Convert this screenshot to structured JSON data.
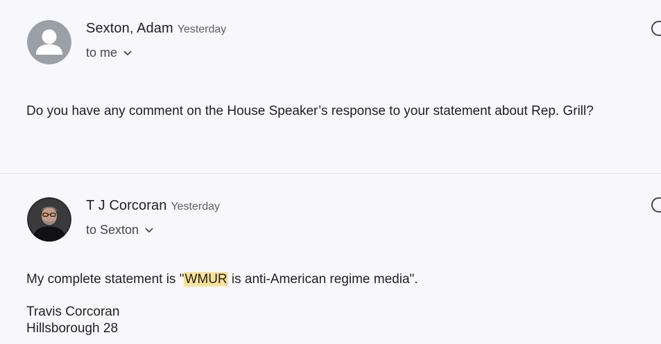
{
  "messages": [
    {
      "sender": "Sexton, Adam",
      "time": "Yesterday",
      "recipient": "to me",
      "body": "Do you have any comment on the House Speaker’s response to your statement about Rep. Grill?"
    },
    {
      "sender": "T J Corcoran",
      "time": "Yesterday",
      "recipient": "to Sexton",
      "body_prefix": "My complete statement is \"",
      "body_highlight": "WMUR",
      "body_suffix": " is anti-American regime media\".",
      "signature_name": "Travis Corcoran",
      "signature_district": "Hillsborough 28"
    }
  ],
  "colors": {
    "background": "#f8f7fc",
    "highlight": "#fbe29a",
    "avatar_placeholder": "#9aa0a6"
  },
  "icons": [
    "default-avatar-icon",
    "chevron-down-icon",
    "more-options-icon"
  ]
}
